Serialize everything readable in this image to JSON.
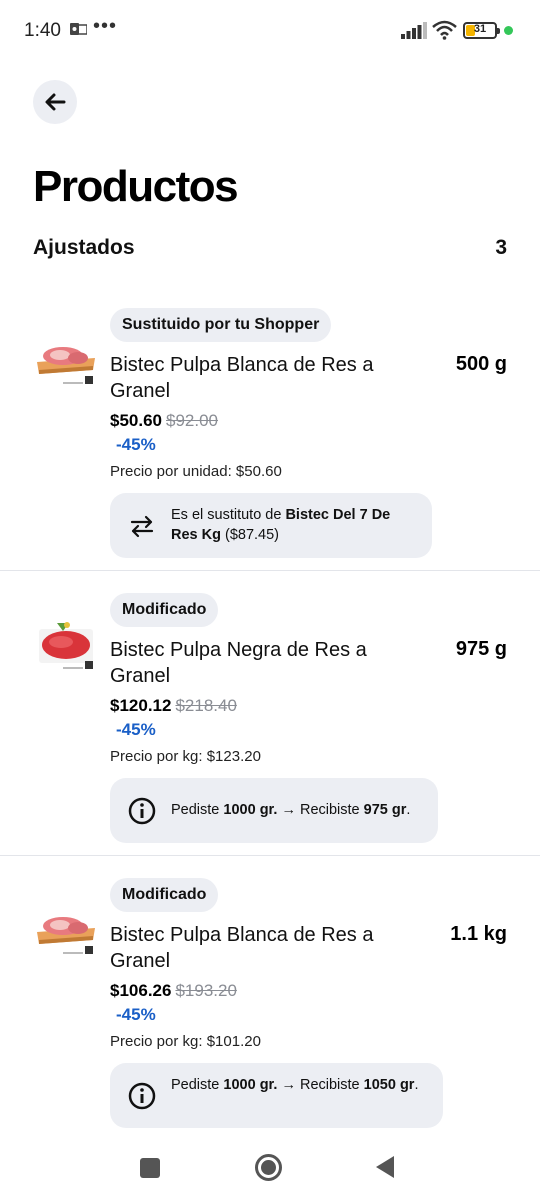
{
  "status_bar": {
    "time": "1:40",
    "dots": "•••",
    "battery": "31"
  },
  "header": {
    "title": "Productos"
  },
  "section": {
    "title": "Ajustados",
    "count": "3"
  },
  "products": [
    {
      "badge": "Sustituido por tu Shopper",
      "name": "Bistec Pulpa Blanca de Res a Granel",
      "qty": "500 g",
      "price": "$50.60",
      "old_price": "$92.00",
      "discount": "-45%",
      "unit_price": "Precio por unidad: $50.60",
      "info_icon": "swap-arrows-icon",
      "info": {
        "prefix": "Es el sustituto de ",
        "bold": "Bistec Del 7 De Res Kg",
        "suffix": " ($87.45)"
      }
    },
    {
      "badge": "Modificado",
      "name": "Bistec Pulpa Negra de Res a Granel",
      "qty": "975 g",
      "price": "$120.12",
      "old_price": "$218.40",
      "discount": "-45%",
      "unit_price": "Precio por kg: $123.20",
      "info_icon": "info-circle-icon",
      "info": {
        "p1": "Pediste ",
        "b1": "1000 gr.",
        "p2": " → Recibiste ",
        "b2": "975 gr",
        "p3": "."
      }
    },
    {
      "badge": "Modificado",
      "name": "Bistec Pulpa Blanca de Res a Granel",
      "qty": "1.1 kg",
      "price": "$106.26",
      "old_price": "$193.20",
      "discount": "-45%",
      "unit_price": "Precio por kg: $101.20",
      "info_icon": "info-circle-icon",
      "info": {
        "p1": "Pediste ",
        "b1": "1000 gr.",
        "p2": " → Recibiste ",
        "b2": "1050 gr",
        "p3": "."
      }
    }
  ],
  "colors": {
    "accent_blue": "#1a5fc7",
    "chip_bg": "#eceef3",
    "strike_gray": "#8a8d94"
  }
}
